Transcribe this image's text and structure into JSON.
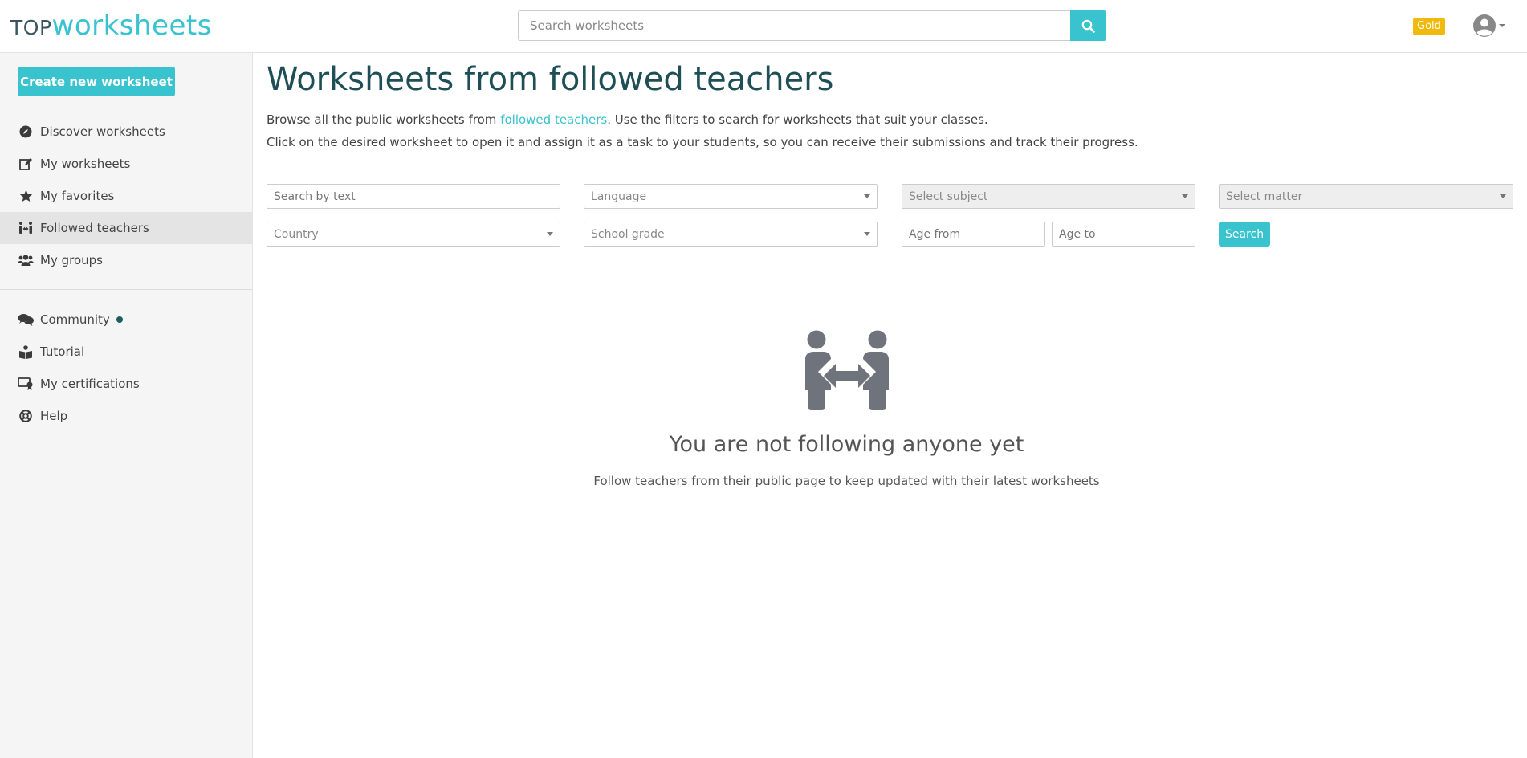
{
  "header": {
    "logo_top": "TOP",
    "logo_worksheets": "worksheets",
    "search_placeholder": "Search worksheets",
    "badge": "Gold"
  },
  "sidebar": {
    "create_button": "Create new worksheet",
    "items": [
      {
        "label": "Discover worksheets",
        "icon": "compass-icon"
      },
      {
        "label": "My worksheets",
        "icon": "edit-icon"
      },
      {
        "label": "My favorites",
        "icon": "star-icon"
      },
      {
        "label": "Followed teachers",
        "icon": "people-arrows-icon",
        "active": true
      },
      {
        "label": "My groups",
        "icon": "users-icon"
      }
    ],
    "items2": [
      {
        "label": "Community",
        "icon": "comments-icon",
        "dot": true
      },
      {
        "label": "Tutorial",
        "icon": "book-reader-icon"
      },
      {
        "label": "My certifications",
        "icon": "certificate-icon"
      },
      {
        "label": "Help",
        "icon": "life-ring-icon"
      }
    ]
  },
  "main": {
    "title": "Worksheets from followed teachers",
    "desc1_before": "Browse all the public worksheets from ",
    "desc1_link": "followed teachers",
    "desc1_after": ". Use the filters to search for worksheets that suit your classes.",
    "desc2": "Click on the desired worksheet to open it and assign it as a task to your students, so you can receive their submissions and track their progress.",
    "filters": {
      "search_text_placeholder": "Search by text",
      "language": "Language",
      "subject": "Select subject",
      "matter": "Select matter",
      "country": "Country",
      "school_grade": "School grade",
      "age_from_placeholder": "Age from",
      "age_to_placeholder": "Age to",
      "search_button": "Search"
    },
    "empty": {
      "icon": "people-arrows-icon",
      "title": "You are not following anyone yet",
      "subtitle": "Follow teachers from their public page to keep updated with their latest worksheets"
    }
  },
  "colors": {
    "accent": "#38c3cf",
    "title": "#1e4f56",
    "badge": "#f0b90b"
  }
}
